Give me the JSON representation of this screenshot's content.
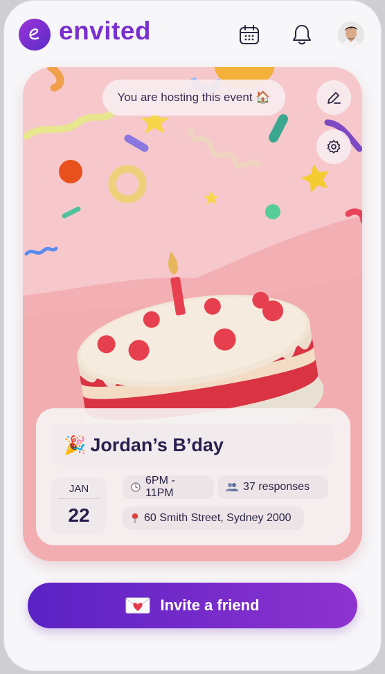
{
  "header": {
    "brand": "envited",
    "logo_letter": "e",
    "icons": [
      "calendar-icon",
      "bell-icon",
      "user-avatar"
    ]
  },
  "event_card": {
    "host_banner": "You are hosting this event 🏠",
    "edit_icon": "pencil-icon",
    "settings_icon": "gear-icon",
    "title_emoji": "🎉",
    "title": "Jordan’s B’day",
    "date": {
      "month": "JAN",
      "day": "22"
    },
    "time": "6PM - 11PM",
    "responses": "37 responses",
    "location": "60 Smith Street, Sydney 2000"
  },
  "cta": {
    "emoji": "💌",
    "label": "Invite a friend"
  },
  "colors": {
    "brand_purple": "#7a2fcf",
    "cta_start": "#5a22c4",
    "cta_end": "#8e33cf",
    "card_pink": "#f6c8cc",
    "text_dark": "#27204e"
  }
}
